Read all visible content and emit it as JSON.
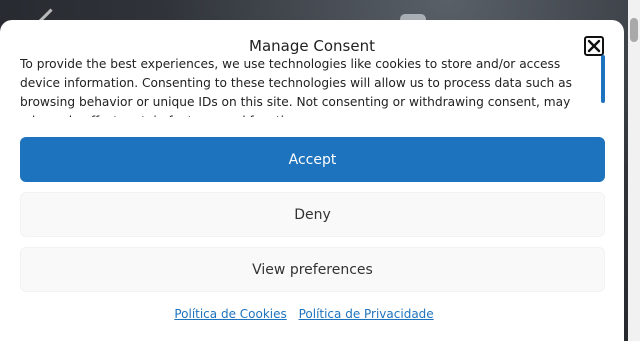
{
  "modal": {
    "title": "Manage Consent",
    "message": "To provide the best experiences, we use technologies like cookies to store and/or access device information. Consenting to these technologies will allow us to process data such as browsing behavior or unique IDs on this site. Not consenting or withdrawing consent, may adversely affect certain features and functions.",
    "buttons": {
      "accept": "Accept",
      "deny": "Deny",
      "preferences": "View preferences"
    },
    "links": {
      "cookies": "Política de Cookies",
      "privacy": "Política de Privacidade"
    }
  },
  "colors": {
    "accent": "#1e73be",
    "secondary_button": "#f9f9f9"
  },
  "icons": {
    "close": "close-icon"
  }
}
